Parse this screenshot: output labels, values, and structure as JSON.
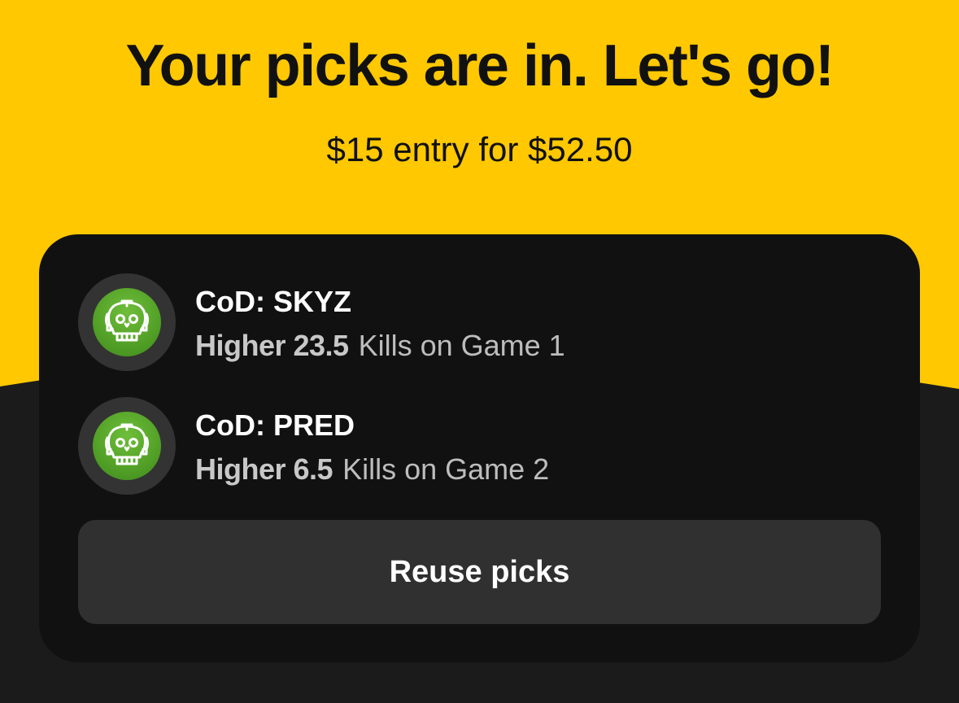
{
  "colors": {
    "header_bg": "#FFC800",
    "page_bg": "#1B1B1B",
    "card_bg": "#111111",
    "button_bg": "#303030",
    "avatar_green": "#4F9D25"
  },
  "header": {
    "title": "Your picks are in. Let's go!",
    "subtitle": "$15 entry for $52.50"
  },
  "picks": [
    {
      "player": "CoD: SKYZ",
      "line": "Higher 23.5",
      "stat": "Kills on Game 1",
      "icon": "skull-headset-icon"
    },
    {
      "player": "CoD: PRED",
      "line": "Higher 6.5",
      "stat": "Kills on Game 2",
      "icon": "skull-headset-icon"
    }
  ],
  "actions": {
    "reuse_label": "Reuse picks"
  }
}
